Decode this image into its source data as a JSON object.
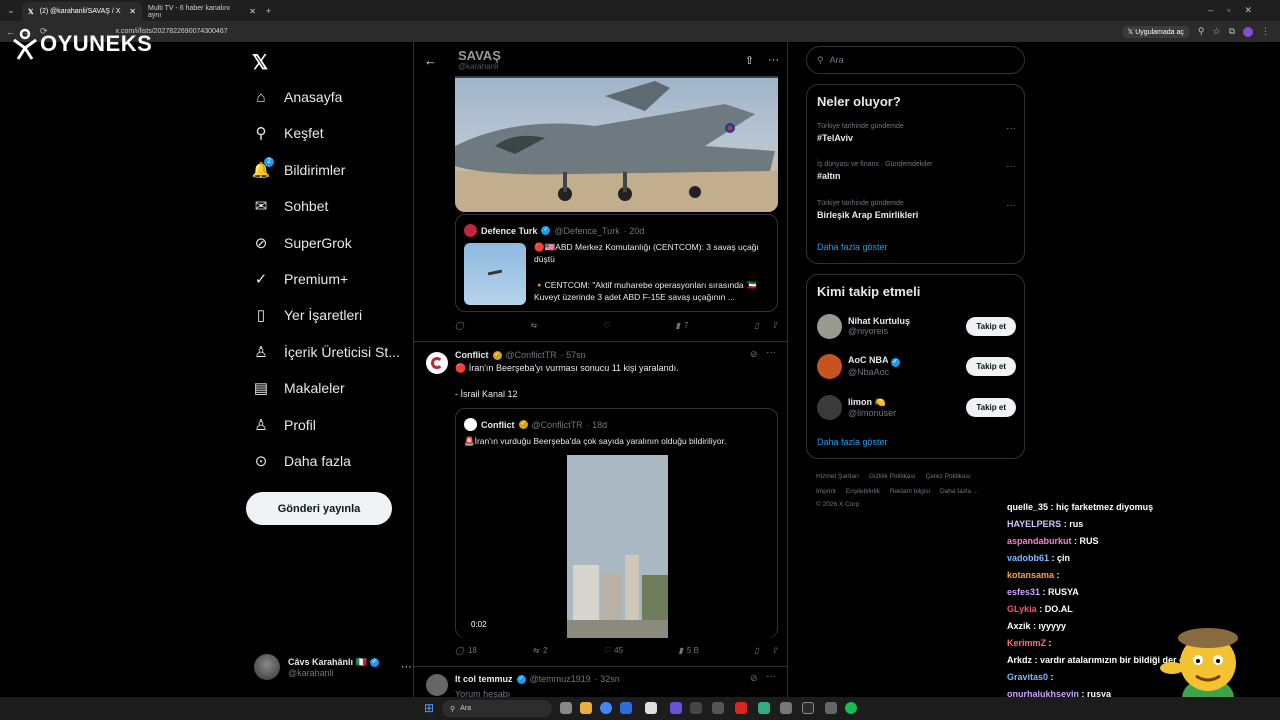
{
  "browser": {
    "tabs": [
      {
        "label": "(2) @karahanli/SAVAŞ / X",
        "active": true
      },
      {
        "label": "Multi TV - 6 haber kanalını aynı",
        "active": false
      }
    ],
    "url": "x.com/i/lists/2027822690074300467",
    "app_button": "Uygulamada aç"
  },
  "brand": {
    "name": "OYUNEKS"
  },
  "nav": {
    "items": [
      {
        "label": "Anasayfa",
        "icon": "home-icon"
      },
      {
        "label": "Keşfet",
        "icon": "search-icon"
      },
      {
        "label": "Bildirimler",
        "icon": "bell-icon",
        "badge": "2"
      },
      {
        "label": "Sohbet",
        "icon": "mail-icon"
      },
      {
        "label": "SuperGrok",
        "icon": "grok-icon"
      },
      {
        "label": "Premium+",
        "icon": "verified-icon"
      },
      {
        "label": "Yer İşaretleri",
        "icon": "bookmark-icon"
      },
      {
        "label": "İçerik Üreticisi St...",
        "icon": "creator-icon"
      },
      {
        "label": "Makaleler",
        "icon": "article-icon"
      },
      {
        "label": "Profil",
        "icon": "person-icon"
      },
      {
        "label": "Daha fazla",
        "icon": "more-circle-icon"
      }
    ],
    "post_button": "Gönderi yayınla",
    "account": {
      "name": "Câvs Karahânlı 🇮🇹",
      "handle": "@karahanli"
    }
  },
  "list_header": {
    "title": "SAVAŞ",
    "subtitle": "@karahanli"
  },
  "tweet1": {
    "quote": {
      "name": "Defence Turk",
      "handle": "@Defence_Turk",
      "time": "· 20d",
      "line1": "🔴🇺🇸ABD Merkez Komutanlığı (CENTCOM): 3 savaş uçağı düştü",
      "line2": "🔸CENTCOM: \"Aktif muharebe operasyonları sırasında 🇰🇼Kuveyt üzerinde 3 adet ABD F-15E savaş uçağının ..."
    },
    "actions": {
      "reply": "",
      "retweet": "",
      "like": "",
      "views": "7"
    }
  },
  "tweet2": {
    "name": "Conflict",
    "handle": "@ConflictTR",
    "time": "· 57sn",
    "text1": "🔴 İran'ın Beerşeba'yı vurması sonucu 11 kişi yaralandı.",
    "text2": "- İsrail Kanal 12",
    "quote": {
      "name": "Conflict",
      "handle": "@ConflictTR",
      "time": "· 18d",
      "text": "🚨İran'ın vurduğu Beerşeba'da çok sayıda yaralının olduğu bildiriliyor.",
      "video_time": "0:02"
    },
    "actions": {
      "reply": "18",
      "retweet": "2",
      "like": "45",
      "views": "5 B"
    }
  },
  "tweet3": {
    "name": "It col temmuz",
    "handle": "@temmuz1919",
    "time": "· 32sn",
    "text": "Yorum hesabı"
  },
  "right": {
    "search_placeholder": "Ara",
    "trends_title": "Neler oluyor?",
    "trends": [
      {
        "context": "Türkiye tarihinde gündemde",
        "name": "#TelAviv"
      },
      {
        "context": "İş dünyası ve finans · Gündemdekiler",
        "name": "#altın"
      },
      {
        "context": "Türkiye tarihinde gündemde",
        "name": "Birleşik Arap Emirlikleri"
      }
    ],
    "show_more": "Daha fazla göster",
    "follow_title": "Kimi takip etmeli",
    "follow": [
      {
        "name": "Nihat Kurtuluş",
        "handle": "@niyoreis",
        "button": "Takip et"
      },
      {
        "name": "AoC NBA",
        "handle": "@NbaAoc",
        "button": "Takip et"
      },
      {
        "name": "limon 🍋",
        "handle": "@limonuser",
        "button": "Takip et"
      }
    ],
    "footer_row1": [
      "Hizmet Şartları",
      "Gizlilik Politikası",
      "Çerez Politikası"
    ],
    "footer_row2": [
      "Imprint",
      "Erişilebilirlik",
      "Reklam bilgisi",
      "Daha fazla ..."
    ],
    "copyright": "© 2026 X Corp."
  },
  "chat": [
    {
      "user": "quelle_35",
      "msg": ": hiç farketmez diyomuş",
      "color": "#ffffff"
    },
    {
      "user": "HAYELPERS",
      "msg": ": rus",
      "color": "#c9c9ff"
    },
    {
      "user": "aspandaburkut",
      "msg": ": RUS",
      "color": "#ff7ad9"
    },
    {
      "user": "vadobb61",
      "msg": ": çin",
      "color": "#7fb6ff"
    },
    {
      "user": "kotansama",
      "msg": ":",
      "color": "#ff9b4d"
    },
    {
      "user": "esfes31",
      "msg": ": RUSYA",
      "color": "#c9a6ff"
    },
    {
      "user": "GLykia",
      "msg": ": DO.AL",
      "color": "#ff4f6a"
    },
    {
      "user": "Axzik",
      "msg": ": ıyyyyy",
      "color": "#ffffff"
    },
    {
      "user": "KerimmZ",
      "msg": ":",
      "color": "#ff6d6d"
    },
    {
      "user": "Arkdz",
      "msg": ": vardır atalarımızın bir bildiği der çini seçerim",
      "color": "#ffffff"
    },
    {
      "user": "Gravitas0",
      "msg": ":",
      "color": "#7fb6ff"
    },
    {
      "user": "onurhalukhseyin",
      "msg": ": rusya",
      "color": "#c9a6ff"
    }
  ],
  "taskbar": {
    "search": "Ara"
  }
}
